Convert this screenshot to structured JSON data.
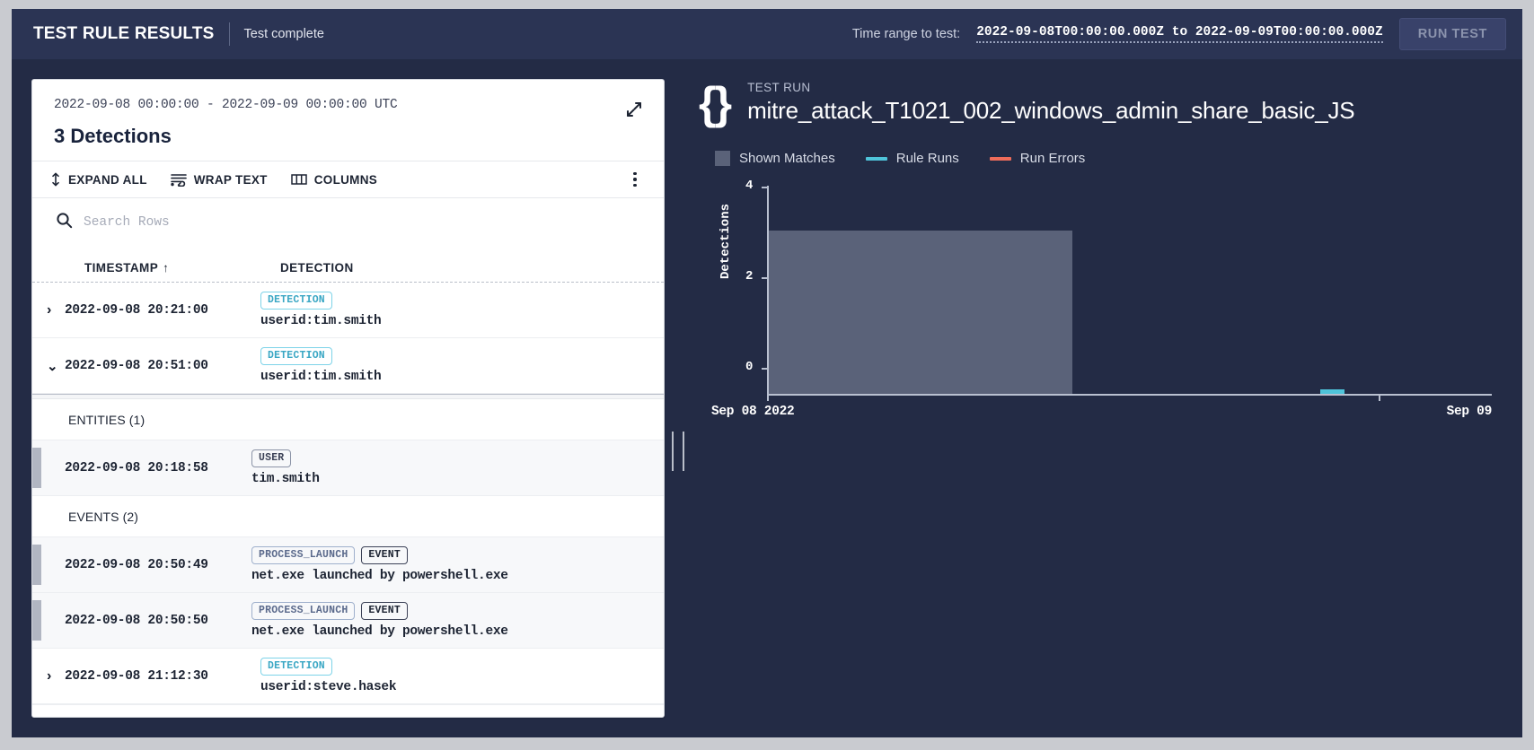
{
  "topbar": {
    "title": "TEST RULE RESULTS",
    "status": "Test complete",
    "range_label": "Time range to test:",
    "range_value": "2022-09-08T00:00:00.000Z to 2022-09-09T00:00:00.000Z",
    "run_test_label": "RUN TEST"
  },
  "results_card": {
    "range": "2022-09-08 00:00:00 - 2022-09-09 00:00:00 UTC",
    "title": "3 Detections",
    "expand_icon": "expand-diagonal-icon",
    "toolbar": {
      "expand_all": "EXPAND ALL",
      "wrap_text": "WRAP TEXT",
      "columns": "COLUMNS",
      "overflow_icon": "kebab-menu-icon"
    },
    "search": {
      "placeholder": "Search Rows",
      "value": "",
      "icon": "search-icon"
    },
    "columns": {
      "timestamp": "TIMESTAMP",
      "sort_arrow": "↑",
      "detection": "DETECTION"
    },
    "rows": [
      {
        "type": "detection",
        "caret": "collapsed",
        "timestamp": "2022-09-08 20:21:00",
        "badges": [
          "DETECTION"
        ],
        "description": "userid:tim.smith"
      },
      {
        "type": "detection",
        "caret": "expanded",
        "timestamp": "2022-09-08 20:51:00",
        "badges": [
          "DETECTION"
        ],
        "description": "userid:tim.smith"
      }
    ],
    "expanded_groups": [
      {
        "label": "ENTITIES (1)",
        "items": [
          {
            "timestamp": "2022-09-08 20:18:58",
            "badges": [
              "USER"
            ],
            "description": "tim.smith"
          }
        ]
      },
      {
        "label": "EVENTS (2)",
        "items": [
          {
            "timestamp": "2022-09-08 20:50:49",
            "badges": [
              "PROCESS_LAUNCH",
              "EVENT"
            ],
            "description": "net.exe launched by powershell.exe"
          },
          {
            "timestamp": "2022-09-08 20:50:50",
            "badges": [
              "PROCESS_LAUNCH",
              "EVENT"
            ],
            "description": "net.exe launched by powershell.exe"
          }
        ]
      }
    ],
    "last_row": {
      "type": "detection",
      "caret": "collapsed",
      "timestamp": "2022-09-08 21:12:30",
      "badges": [
        "DETECTION"
      ],
      "description": "userid:steve.hasek"
    }
  },
  "test_run": {
    "icon": "curly-braces-icon",
    "kicker": "TEST RUN",
    "name": "mitre_attack_T1021_002_windows_admin_share_basic_JS"
  },
  "colors": {
    "shown_matches": "#5a6279",
    "rule_runs": "#4fc4da",
    "run_errors": "#ef6c5a",
    "panel_bg": "#232b45",
    "topbar_bg": "#2b3454",
    "badge_detection": "#3aa7c4"
  },
  "chart_data": {
    "type": "bar",
    "title": "",
    "xlabel": "",
    "ylabel": "Detections",
    "ylim": [
      0,
      4
    ],
    "yticks": [
      0,
      2,
      4
    ],
    "ytick_labels": [
      "0",
      "2",
      "4"
    ],
    "xticks": [
      "Sep 08 2022",
      "Sep 09"
    ],
    "x_range": [
      "2022-09-08T00:00:00.000Z",
      "2022-09-09T00:00:00.000Z"
    ],
    "grid": false,
    "legend_position": "top-left",
    "series": [
      {
        "name": "Shown Matches",
        "color": "#5a6279",
        "type": "bar",
        "values": [
          3
        ],
        "bar_start_frac": 0.0,
        "bar_end_frac": 0.432
      },
      {
        "name": "Rule Runs",
        "color": "#4fc4da",
        "type": "line",
        "values": [
          0
        ],
        "segment_start_frac": 0.885,
        "segment_end_frac": 0.918
      },
      {
        "name": "Run Errors",
        "color": "#ef6c5a",
        "type": "line",
        "values": []
      }
    ]
  }
}
